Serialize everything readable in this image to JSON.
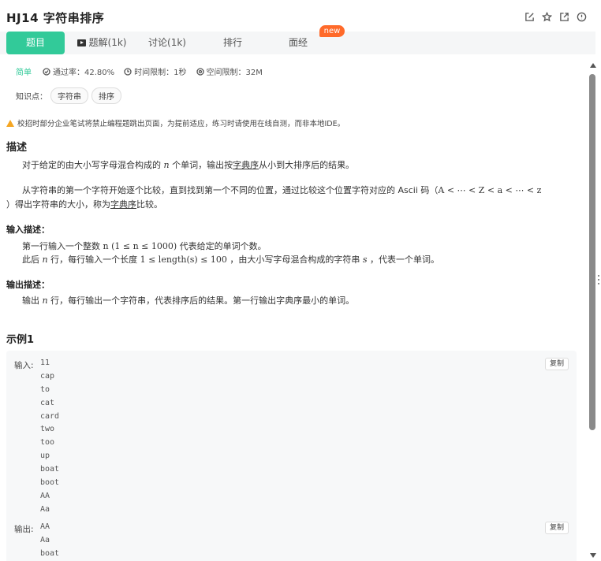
{
  "title": "HJ14  字符串排序",
  "header_icons": [
    "edit-icon",
    "star-icon",
    "share-icon",
    "info-icon"
  ],
  "tabs": [
    {
      "label": "题目",
      "active": true
    },
    {
      "label": "题解(1k)",
      "icon": "video-icon"
    },
    {
      "label": "讨论(1k)"
    },
    {
      "label": "排行"
    },
    {
      "label": "面经"
    }
  ],
  "new_badge": "new",
  "meta": {
    "difficulty": "简单",
    "pass_rate": "通过率：42.80%",
    "time_limit": "时间限制：1秒",
    "space_limit": "空间限制：32M"
  },
  "knowledge": {
    "label": "知识点：",
    "tags": [
      "字符串",
      "排序"
    ]
  },
  "warning": "校招时部分企业笔试将禁止编程题跳出页面，为提前适应，练习时请使用在线自测，而非本地IDE。",
  "description": {
    "heading": "描述",
    "p1_pre": "对于给定的由大小写字母混合构成的 ",
    "p1_math": "n",
    "p1_mid": " 个单词，输出按",
    "p1_link": "字典序",
    "p1_post": "从小到大排序后的结果。",
    "p2_pre": "从字符串的第一个字符开始逐个比较，直到找到第一个不同的位置，通过比较这个位置字符对应的 Ascii 码（",
    "p2_math": "A < ⋯ < Z < a < ⋯ < z",
    "p2_line2_pre": "）得出字符串的大小，称为",
    "p2_link": "字典序",
    "p2_post": "比较。"
  },
  "input_desc": {
    "heading": "输入描述：",
    "l1_pre": "第一行输入一个整数 ",
    "l1_math": "n (1 ≤ n ≤ 1000)",
    "l1_post": " 代表给定的单词个数。",
    "l2_pre": "此后 ",
    "l2_math1": "n",
    "l2_mid1": " 行，每行输入一个长度 ",
    "l2_math2": "1 ≤ length(s) ≤ 100",
    "l2_mid2": " ，由大小写字母混合构成的字符串 ",
    "l2_math3": "s",
    "l2_post": " ，代表一个单词。"
  },
  "output_desc": {
    "heading": "输出描述：",
    "l1_pre": "输出 ",
    "l1_math": "n",
    "l1_post": " 行，每行输出一个字符串，代表排序后的结果。第一行输出字典序最小的单词。"
  },
  "example": {
    "heading": "示例1",
    "input_label": "输入:",
    "output_label": "输出:",
    "copy_label": "复制",
    "input_lines": [
      "11",
      "cap",
      "to",
      "cat",
      "card",
      "two",
      "too",
      "up",
      "boat",
      "boot",
      "AA",
      "Aa"
    ],
    "output_lines": [
      "AA",
      "Aa",
      "boat"
    ]
  },
  "colors": {
    "accent": "#32ca99",
    "badge": "#ff6a2a",
    "warning": "#f5a623"
  }
}
